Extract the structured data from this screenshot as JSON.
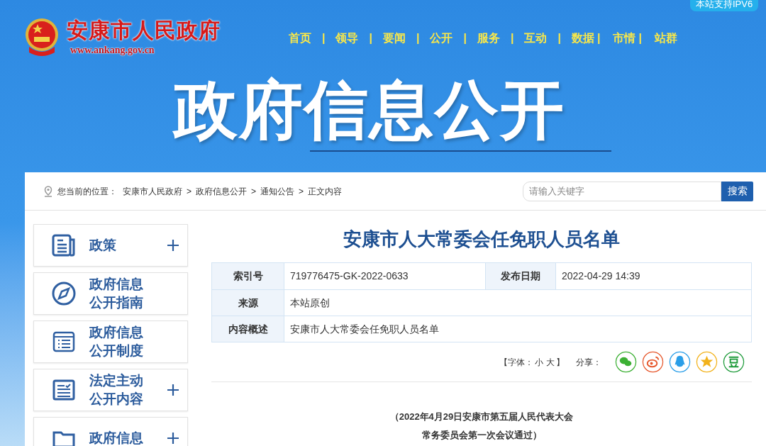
{
  "header": {
    "site_name": "安康市人民政府",
    "site_url": "www.ankang.gov.cn",
    "ipv6_badge": "本站支持IPV6",
    "nav": [
      {
        "label": "首页",
        "divider": "|"
      },
      {
        "label": "领导",
        "divider": "|"
      },
      {
        "label": "要闻",
        "divider": "|"
      },
      {
        "label": "公开",
        "divider": "|"
      },
      {
        "label": "服务",
        "divider": "|"
      },
      {
        "label": "互动",
        "divider": "|"
      },
      {
        "label": "数据",
        "divider": "|"
      },
      {
        "label": "市情",
        "divider": "|"
      },
      {
        "label": "站群"
      }
    ],
    "banner_title": "政府信息公开"
  },
  "breadcrumb": {
    "prefix": "您当前的位置：",
    "items": [
      "安康市人民政府",
      "政府信息公开",
      "通知公告",
      "正文内容"
    ],
    "separator": ">"
  },
  "search": {
    "placeholder": "请输入关键字",
    "button": "搜索"
  },
  "sidebar": {
    "items": [
      {
        "label": "政策",
        "expandable": true
      },
      {
        "label": "政府信息公开指南",
        "expandable": false
      },
      {
        "label": "政府信息公开制度",
        "expandable": false
      },
      {
        "label": "法定主动公开内容",
        "expandable": true
      },
      {
        "label": "政府信息",
        "expandable": true
      }
    ]
  },
  "article": {
    "title": "安康市人大常委会任免职人员名单",
    "meta": [
      {
        "label": "索引号",
        "value": "719776475-GK-2022-0633",
        "label_2": "发布日期",
        "value_2": "2022-04-29 14:39"
      },
      {
        "label": "来源",
        "value": "本站原创"
      },
      {
        "label": "内容概述",
        "value": "安康市人大常委会任免职人员名单"
      }
    ],
    "font_size": {
      "open": "【字体：",
      "small": "小",
      "large": "大",
      "close": "】"
    },
    "share_label": "分享：",
    "share": [
      {
        "color": "#3cb034"
      },
      {
        "color": "#e6572c"
      },
      {
        "color": "#2a9ee8"
      },
      {
        "color": "#f2b21c"
      },
      {
        "color": "#1f9b3b"
      }
    ],
    "subtitle": [
      "（2022年4月29日安康市第五届人民代表大会",
      "常务委员会第一次会议通过）"
    ]
  }
}
